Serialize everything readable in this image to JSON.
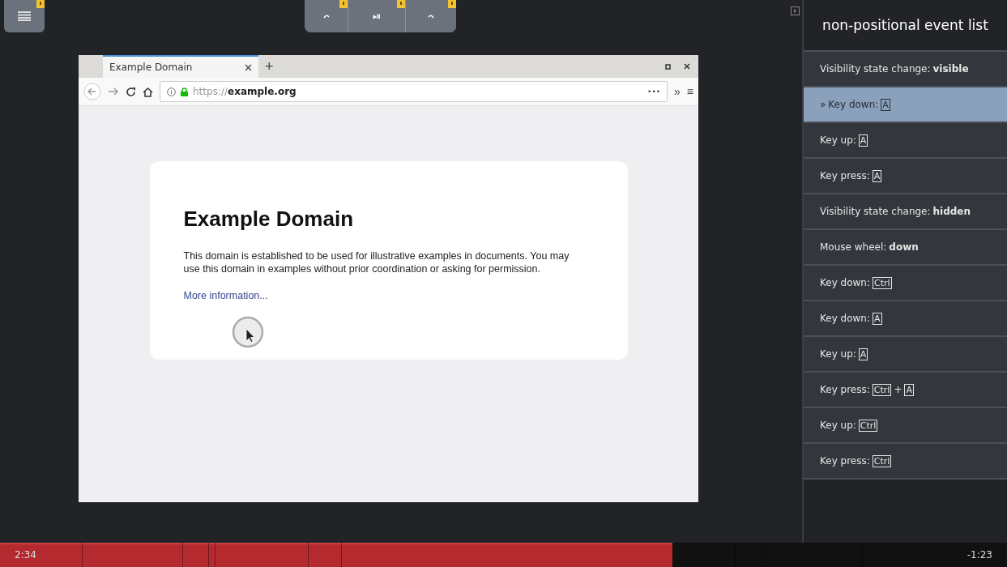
{
  "toolbar": {
    "play_pause": "⏯"
  },
  "browser": {
    "tab_title": "Example Domain",
    "new_tab": "+",
    "url_scheme": "https://",
    "url_host": "example.org",
    "more": "•••",
    "overflow": "»",
    "menu": "≡"
  },
  "page": {
    "heading": "Example Domain",
    "paragraph": "This domain is established to be used for illustrative examples in documents. You may use this domain in examples without prior coordination or asking for permission.",
    "link": "More information..."
  },
  "sidebar": {
    "title": "non-positional event list",
    "events": [
      {
        "label": "Visibility state change:",
        "selected": false,
        "parts": [
          {
            "kind": "bold",
            "text": "visible"
          }
        ]
      },
      {
        "label": "Key down:",
        "selected": true,
        "prefix": "»",
        "parts": [
          {
            "kind": "key",
            "text": "A"
          }
        ]
      },
      {
        "label": "Key up:",
        "selected": false,
        "parts": [
          {
            "kind": "key",
            "text": "A"
          }
        ]
      },
      {
        "label": "Key press:",
        "selected": false,
        "parts": [
          {
            "kind": "key",
            "text": "A"
          }
        ]
      },
      {
        "label": "Visibility state change:",
        "selected": false,
        "parts": [
          {
            "kind": "bold",
            "text": "hidden"
          }
        ]
      },
      {
        "label": "Mouse wheel:",
        "selected": false,
        "parts": [
          {
            "kind": "bold",
            "text": "down"
          }
        ]
      },
      {
        "label": "Key down:",
        "selected": false,
        "parts": [
          {
            "kind": "key",
            "text": "Ctrl"
          }
        ]
      },
      {
        "label": "Key down:",
        "selected": false,
        "parts": [
          {
            "kind": "key",
            "text": "A"
          }
        ]
      },
      {
        "label": "Key up:",
        "selected": false,
        "parts": [
          {
            "kind": "key",
            "text": "A"
          }
        ]
      },
      {
        "label": "Key press:",
        "selected": false,
        "parts": [
          {
            "kind": "key",
            "text": "Ctrl"
          },
          {
            "kind": "plain",
            "text": "+"
          },
          {
            "kind": "key",
            "text": "A"
          }
        ]
      },
      {
        "label": "Key up:",
        "selected": false,
        "parts": [
          {
            "kind": "key",
            "text": "Ctrl"
          }
        ]
      },
      {
        "label": "Key press:",
        "selected": false,
        "parts": [
          {
            "kind": "key",
            "text": "Ctrl"
          }
        ]
      }
    ]
  },
  "timeline": {
    "elapsed": "2:34",
    "remaining": "-1:23",
    "level": 0.668
  }
}
